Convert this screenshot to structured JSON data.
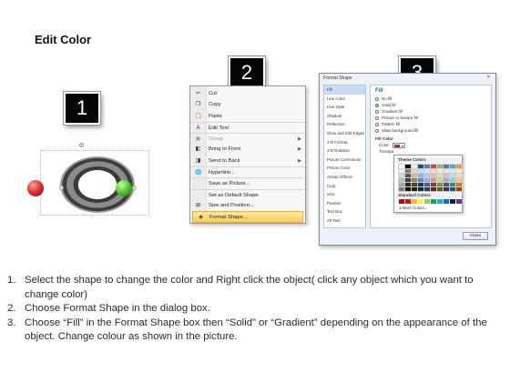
{
  "page": {
    "title": "Edit Color"
  },
  "badges": [
    "1",
    "2",
    "3"
  ],
  "context_menu": {
    "items": [
      {
        "label": "Cut",
        "icon": "scissors-icon",
        "glyph": "✂",
        "enabled": true,
        "submenu": false,
        "sep_before": false
      },
      {
        "label": "Copy",
        "icon": "copy-icon",
        "glyph": "❐",
        "enabled": true,
        "submenu": false,
        "sep_before": false
      },
      {
        "label": "Paste",
        "icon": "paste-icon",
        "glyph": "📋",
        "enabled": true,
        "submenu": false,
        "sep_before": false
      },
      {
        "label": "Edit Text",
        "icon": "edit-text-icon",
        "glyph": "A",
        "enabled": true,
        "submenu": false,
        "sep_before": true
      },
      {
        "label": "Group",
        "icon": "group-icon",
        "glyph": "▣",
        "enabled": false,
        "submenu": true,
        "sep_before": true
      },
      {
        "label": "Bring to Front",
        "icon": "bring-to-front-icon",
        "glyph": "◧",
        "enabled": true,
        "submenu": true,
        "sep_before": false
      },
      {
        "label": "Send to Back",
        "icon": "send-to-back-icon",
        "glyph": "◨",
        "enabled": true,
        "submenu": true,
        "sep_before": false
      },
      {
        "label": "Hyperlink...",
        "icon": "hyperlink-icon",
        "glyph": "🌐",
        "enabled": true,
        "submenu": false,
        "sep_before": true
      },
      {
        "label": "Save as Picture...",
        "icon": "",
        "glyph": "",
        "enabled": true,
        "submenu": false,
        "sep_before": true
      },
      {
        "label": "Set as Default Shape",
        "icon": "",
        "glyph": "",
        "enabled": true,
        "submenu": false,
        "sep_before": true
      },
      {
        "label": "Size and Position...",
        "icon": "size-position-icon",
        "glyph": "⊞",
        "enabled": true,
        "submenu": false,
        "sep_before": false
      },
      {
        "label": "Format Shape...",
        "icon": "format-shape-icon",
        "glyph": "◈",
        "enabled": true,
        "submenu": false,
        "sep_before": false,
        "highlighted": true
      }
    ]
  },
  "format_dialog": {
    "title": "Format Shape",
    "categories": [
      "Fill",
      "Line Color",
      "Line Style",
      "Shadow",
      "Reflection",
      "Glow and Soft Edges",
      "3-D Format",
      "3-D Rotation",
      "Picture Corrections",
      "Picture Color",
      "Artistic Effects",
      "Crop",
      "Size",
      "Position",
      "Text Box",
      "Alt Text"
    ],
    "selected_category": "Fill",
    "section_title": "Fill",
    "fill_options": [
      {
        "label": "No fill",
        "selected": false
      },
      {
        "label": "Solid fill",
        "selected": true
      },
      {
        "label": "Gradient fill",
        "selected": false
      },
      {
        "label": "Picture or texture fill",
        "selected": false
      },
      {
        "label": "Pattern fill",
        "selected": false
      },
      {
        "label": "Slide background fill",
        "selected": false
      }
    ],
    "fill_color_label": "Fill Color",
    "color_label": "Color:",
    "transparency_label": "Transpa",
    "close_button": "Close",
    "current_color": "#c0202a"
  },
  "color_picker": {
    "theme_title": "Theme Colors",
    "standard_title": "Standard Colors",
    "more_colors": "More Colors...",
    "theme_colors": [
      [
        "#ffffff",
        "#000000",
        "#eeece1",
        "#1f497d",
        "#4f81bd",
        "#c0504d",
        "#9bbb59",
        "#8064a2",
        "#4bacc6",
        "#f79646"
      ],
      [
        "#f2f2f2",
        "#7f7f7f",
        "#ddd9c3",
        "#c6d9f0",
        "#dbe5f1",
        "#f2dcdb",
        "#ebf1dd",
        "#e5e0ec",
        "#dbeef3",
        "#fdeada"
      ],
      [
        "#d8d8d8",
        "#595959",
        "#c4bd97",
        "#8db3e2",
        "#b8cce4",
        "#e5b9b7",
        "#d7e3bc",
        "#ccc1d9",
        "#b7dde8",
        "#fbd5b5"
      ],
      [
        "#bfbfbf",
        "#3f3f3f",
        "#938953",
        "#548dd4",
        "#95b3d7",
        "#d99694",
        "#c3d69b",
        "#b2a2c7",
        "#92cddc",
        "#fac08f"
      ],
      [
        "#a5a5a5",
        "#262626",
        "#494429",
        "#17365d",
        "#366092",
        "#953734",
        "#76923c",
        "#5f497a",
        "#31859b",
        "#e36c09"
      ],
      [
        "#7f7f7f",
        "#0c0c0c",
        "#1d1b10",
        "#0f243e",
        "#244061",
        "#632423",
        "#4f6128",
        "#3f3151",
        "#205867",
        "#974806"
      ]
    ],
    "standard_colors": [
      "#c00000",
      "#ff0000",
      "#ffc000",
      "#ffff00",
      "#92d050",
      "#00b050",
      "#00b0f0",
      "#0070c0",
      "#002060",
      "#7030a0"
    ]
  },
  "instructions": [
    {
      "num": "1.",
      "text": "Select the shape to change the color and Right click the object( click any object which you want to change color)"
    },
    {
      "num": "2.",
      "text": "Choose Format Shape in the dialog box."
    },
    {
      "num": "3.",
      "text": "Choose “Fill” in the Format Shape box then “Solid” or “Gradient” depending on the appearance of the object. Change colour as shown in the picture."
    }
  ]
}
